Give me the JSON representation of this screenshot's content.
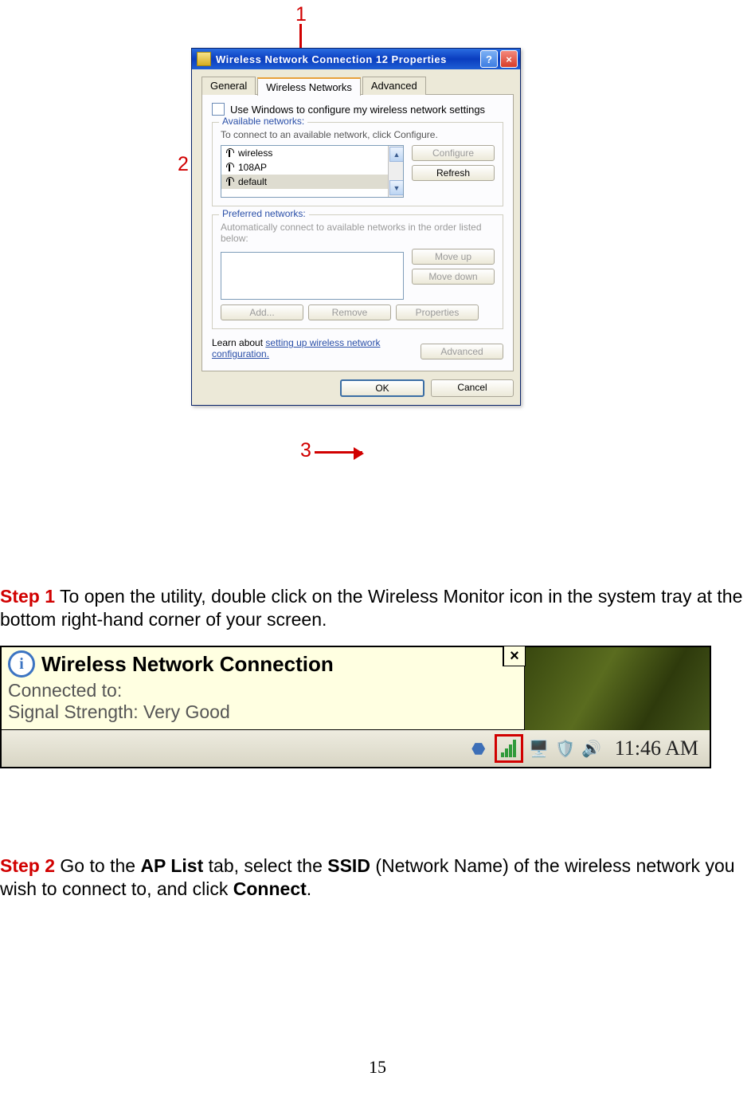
{
  "callouts": {
    "one": "1",
    "two": "2",
    "three": "3"
  },
  "dialog": {
    "title": "Wireless Network Connection 12 Properties",
    "help_btn": "?",
    "close_btn": "×",
    "tabs": {
      "general": "General",
      "wireless": "Wireless Networks",
      "advanced": "Advanced"
    },
    "checkbox_label": "Use Windows to configure my wireless network settings",
    "avail_group_title": "Available networks:",
    "avail_help": "To connect to an available network, click Configure.",
    "networks": {
      "n0": "wireless",
      "n1": "108AP",
      "n2": "default"
    },
    "btn_configure": "Configure",
    "btn_refresh": "Refresh",
    "pref_group_title": "Preferred networks:",
    "pref_help": "Automatically connect to available networks in the order listed below:",
    "btn_moveup": "Move up",
    "btn_movedown": "Move down",
    "btn_add": "Add...",
    "btn_remove": "Remove",
    "btn_props": "Properties",
    "learn_text": "Learn about ",
    "learn_link": "setting up wireless network configuration.",
    "btn_adv": "Advanced",
    "btn_ok": "OK",
    "btn_cancel": "Cancel"
  },
  "step1": {
    "label": "Step 1",
    "text": " To open the utility, double click on the Wireless Monitor icon in the system tray at the bottom right-hand corner of your screen."
  },
  "tooltip": {
    "title": "Wireless Network Connection",
    "close": "×",
    "line1": "Connected to:",
    "line2": "Signal Strength: Very Good"
  },
  "tray": {
    "time": "11:46 AM"
  },
  "step2": {
    "label": "Step 2",
    "t1": " Go to the ",
    "b1": "AP List",
    "t2": " tab, select the ",
    "b2": "SSID",
    "t3": " (Network Name) of the wireless network you wish to connect to, and click ",
    "b3": "Connect",
    "t4": "."
  },
  "page_number": "15"
}
